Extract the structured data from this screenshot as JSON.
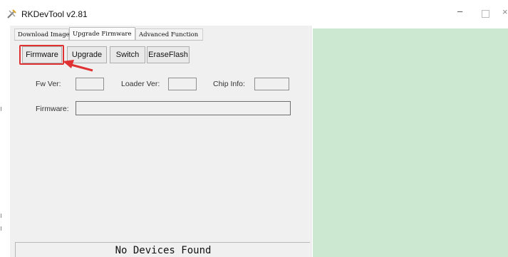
{
  "window": {
    "title": "RKDevTool v2.81",
    "minimize_glyph": "–",
    "close_glyph": "×"
  },
  "tabs": [
    {
      "label": "Download Image"
    },
    {
      "label": "Upgrade Firmware"
    },
    {
      "label": "Advanced Function"
    }
  ],
  "active_tab": "Upgrade Firmware",
  "toolbar": {
    "firmware_label": "Firmware",
    "upgrade_label": "Upgrade",
    "switch_label": "Switch",
    "eraseflash_label": "EraseFlash"
  },
  "info": {
    "fw_ver_label": "Fw Ver:",
    "fw_ver_value": "",
    "loader_ver_label": "Loader Ver:",
    "loader_ver_value": "",
    "chip_info_label": "Chip Info:",
    "chip_info_value": "",
    "firmware_label": "Firmware:",
    "firmware_value": ""
  },
  "status": {
    "text": "No Devices Found"
  },
  "colors": {
    "log_background": "#cce8d0",
    "highlight": "#e03232"
  },
  "icons": {
    "app": "rk-tool-icon",
    "annotation": "red-arrow"
  }
}
